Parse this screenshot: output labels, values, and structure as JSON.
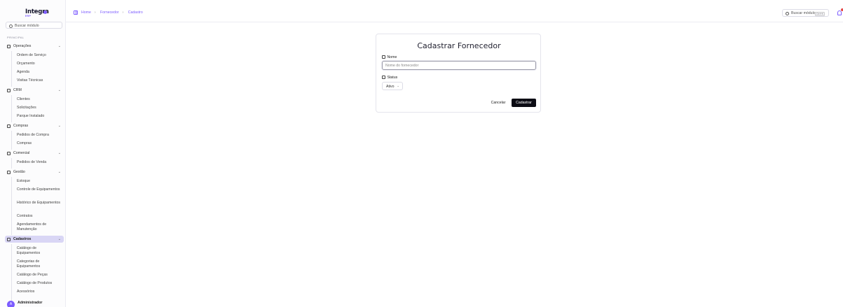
{
  "sidebar": {
    "logo": {
      "name": "Integra",
      "sub": "ERP"
    },
    "search_placeholder": "Buscar módulo",
    "section_label": "PRINCIPAL",
    "groups": [
      {
        "label": "Operações",
        "icon": "activity-icon",
        "items": [
          "Ordem de Serviço",
          "Orçamento",
          "Agenda",
          "Visitas Técnicas"
        ]
      },
      {
        "label": "CRM",
        "icon": "target-icon",
        "items": [
          "Clientes",
          "Solicitações",
          "Parque Instalado"
        ]
      },
      {
        "label": "Compras",
        "icon": "cart-icon",
        "items": [
          "Pedidos de Compra",
          "Compras"
        ]
      },
      {
        "label": "Comercial",
        "icon": "store-icon",
        "items": [
          "Pedidos de Venda"
        ]
      },
      {
        "label": "Gestão",
        "icon": "wallet-icon",
        "items": [
          "Estoque",
          "Controle de Equipamentos",
          "Histórico de Equipamentos",
          "Contratos",
          "Agendamentos de Manutenção"
        ]
      },
      {
        "label": "Cadastros",
        "icon": "file-icon",
        "items": [
          "Catálogo de Equipamentos",
          "Categorias de Equipamentos",
          "Catálogo de Peças",
          "Catálogo de Produtos",
          "Acessórios"
        ]
      }
    ],
    "user": {
      "initial": "A",
      "name": "Administrador"
    }
  },
  "header": {
    "breadcrumb": [
      "Home",
      "Fornecedor",
      "Cadastro"
    ],
    "search_placeholder": "Buscar módulo...",
    "search_shortcut": "Ctrl+K"
  },
  "form": {
    "title": "Cadastrar Fornecedor",
    "name_label": "Nome",
    "name_placeholder": "Nome do fornecedor",
    "name_value": "",
    "status_label": "Status",
    "status_value": "Ativo",
    "cancel_label": "Cancelar",
    "submit_label": "Cadastrar"
  },
  "colors": {
    "accent": "#7c5cff",
    "active_bg": "#d9d6f5",
    "primary_button": "#0c0c14"
  }
}
